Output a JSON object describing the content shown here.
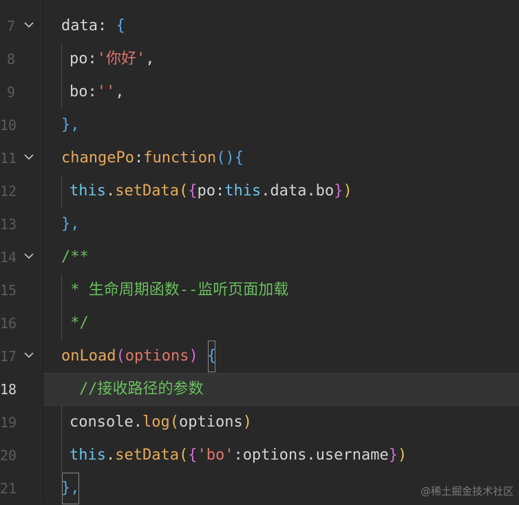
{
  "editor": {
    "lines": [
      {
        "num": "7",
        "fold": true
      },
      {
        "num": "8"
      },
      {
        "num": "9"
      },
      {
        "num": "10"
      },
      {
        "num": "11",
        "fold": true
      },
      {
        "num": "12"
      },
      {
        "num": "13"
      },
      {
        "num": "14",
        "fold": true
      },
      {
        "num": "15"
      },
      {
        "num": "16"
      },
      {
        "num": "17",
        "fold": true
      },
      {
        "num": "18",
        "current": true
      },
      {
        "num": "19"
      },
      {
        "num": "20"
      },
      {
        "num": "21"
      }
    ],
    "tokens": {
      "l7_data": "data",
      "l7_colon": ": ",
      "l7_brace": "{",
      "l8_po": "po",
      "l8_colon": ":",
      "l8_str": "'你好'",
      "l8_comma": ",",
      "l9_bo": "bo",
      "l9_colon": ":",
      "l9_str": "''",
      "l9_comma": ",",
      "l10_close": "},",
      "l11_name": "changePo",
      "l11_colon": ":",
      "l11_kw": "function",
      "l11_paren": "()",
      "l11_brace": "{",
      "l12_this": "this",
      "l12_dot": ".",
      "l12_method": "setData",
      "l12_paren_open": "(",
      "l12_brace_open": "{",
      "l12_po": "po",
      "l12_colon": ":",
      "l12_this2": "this",
      "l12_rest": ".data.bo",
      "l12_brace_close": "}",
      "l12_paren_close": ")",
      "l13_close": "},",
      "l14_comment": "/**",
      "l15_comment": " * 生命周期函数--监听页面加载",
      "l16_comment": " */",
      "l17_name": "onLoad",
      "l17_paren_open": "(",
      "l17_param": "options",
      "l17_paren_close": ")",
      "l17_space": " ",
      "l17_brace": "{",
      "l18_comment": "//接收路径的参数",
      "l19_console": "console",
      "l19_dot": ".",
      "l19_method": "log",
      "l19_paren_open": "(",
      "l19_arg": "options",
      "l19_paren_close": ")",
      "l20_this": "this",
      "l20_dot": ".",
      "l20_method": "setData",
      "l20_paren_open": "(",
      "l20_brace_open": "{",
      "l20_str": "'bo'",
      "l20_colon": ":",
      "l20_rest": "options.username",
      "l20_brace_close": "}",
      "l20_paren_close": ")",
      "l21_close": "},"
    }
  },
  "watermark": "@稀土掘金技术社区",
  "colors": {
    "background": "#282828",
    "string": "#e0766a",
    "function": "#e7a95b",
    "comment": "#6abf5e",
    "this": "#6cc3e8"
  }
}
